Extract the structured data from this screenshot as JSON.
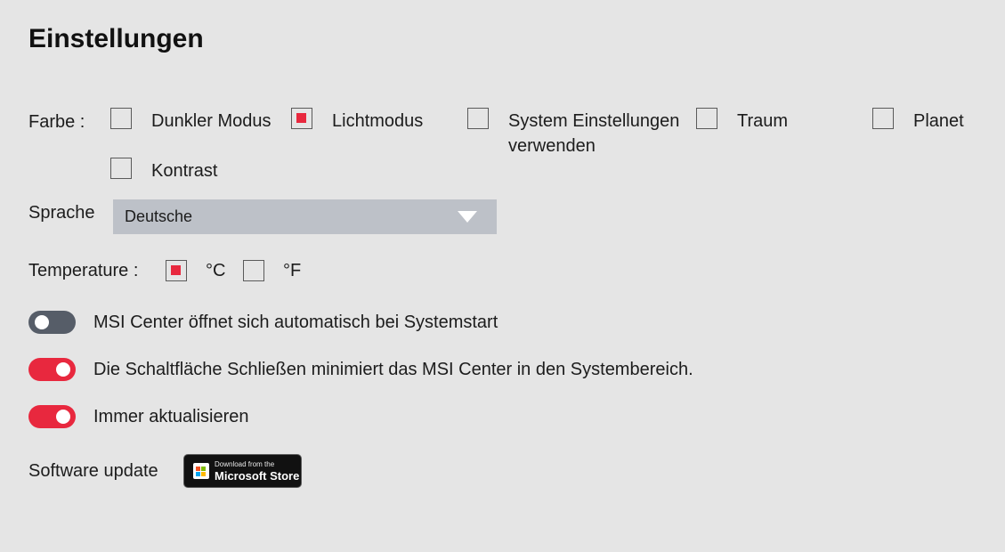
{
  "title": "Einstellungen",
  "farbe": {
    "label": "Farbe :",
    "options": [
      {
        "label": "Dunkler Modus",
        "checked": false
      },
      {
        "label": "Lichtmodus",
        "checked": true
      },
      {
        "label_line1": "System Einstellungen",
        "label_line2": "verwenden",
        "checked": false
      },
      {
        "label": "Traum",
        "checked": false
      },
      {
        "label": "Planet",
        "checked": false
      },
      {
        "label": "Kontrast",
        "checked": false
      }
    ]
  },
  "sprache": {
    "label": "Sprache",
    "selected": "Deutsche"
  },
  "temperature": {
    "label": "Temperature :",
    "options": [
      {
        "label": "°C",
        "checked": true
      },
      {
        "label": "°F",
        "checked": false
      }
    ]
  },
  "toggles": [
    {
      "label": "MSI Center öffnet sich automatisch bei Systemstart",
      "on": false
    },
    {
      "label": "Die Schaltfläche Schließen minimiert das MSI Center in den Systembereich.",
      "on": true
    },
    {
      "label": "Immer aktualisieren",
      "on": true
    }
  ],
  "software_update": {
    "label": "Software update",
    "store_small": "Download from the",
    "store_big": "Microsoft Store"
  },
  "colors": {
    "background": "#e5e5e5",
    "accent": "#e8283e",
    "toggle_off": "#565d68",
    "select_bg": "#bdc1c8"
  }
}
